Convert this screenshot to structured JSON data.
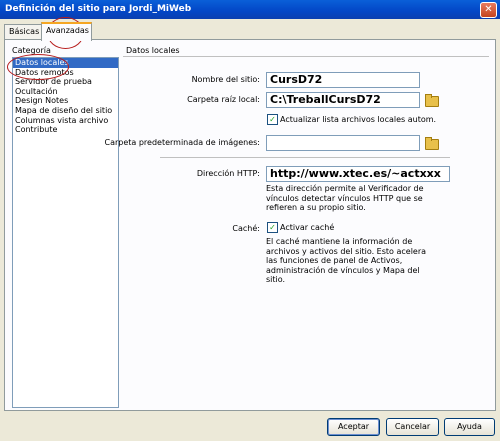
{
  "window": {
    "title": "Definición del sitio para Jordi_MiWeb",
    "close_glyph": "✕"
  },
  "tabs": [
    {
      "label": "Básicas"
    },
    {
      "label": "Avanzadas"
    }
  ],
  "left": {
    "header": "Categoría",
    "items": [
      {
        "label": "Datos locales"
      },
      {
        "label": "Datos remotos"
      },
      {
        "label": "Servidor de prueba"
      },
      {
        "label": "Ocultación"
      },
      {
        "label": "Design Notes"
      },
      {
        "label": "Mapa de diseño del sitio"
      },
      {
        "label": "Columnas vista archivo"
      },
      {
        "label": "Contribute"
      }
    ]
  },
  "section": {
    "title": "Datos locales"
  },
  "form": {
    "site_name_label": "Nombre del sitio:",
    "site_name_value": "CursD72",
    "root_folder_label": "Carpeta raíz local:",
    "root_folder_value": "C:\\TreballCursD72",
    "refresh_label": "Actualizar lista archivos locales autom.",
    "default_images_label": "Carpeta predeterminada de imágenes:",
    "default_images_value": "",
    "http_label": "Dirección HTTP:",
    "http_value": "http://www.xtec.es/~actxxx",
    "http_note": "Esta dirección permite al Verificador de vínculos detectar vínculos HTTP que se refieren a su propio sitio.",
    "cache_label": "Caché:",
    "cache_checkbox_label": "Activar caché",
    "cache_note": "El caché mantiene la información de archivos y activos del sitio. Esto acelera las funciones de panel de Activos, administración de vínculos y Mapa del sitio."
  },
  "buttons": {
    "accept": "Aceptar",
    "cancel": "Cancelar",
    "help": "Ayuda"
  },
  "checkmark": "✓",
  "annotation_color": "#b71c1c"
}
